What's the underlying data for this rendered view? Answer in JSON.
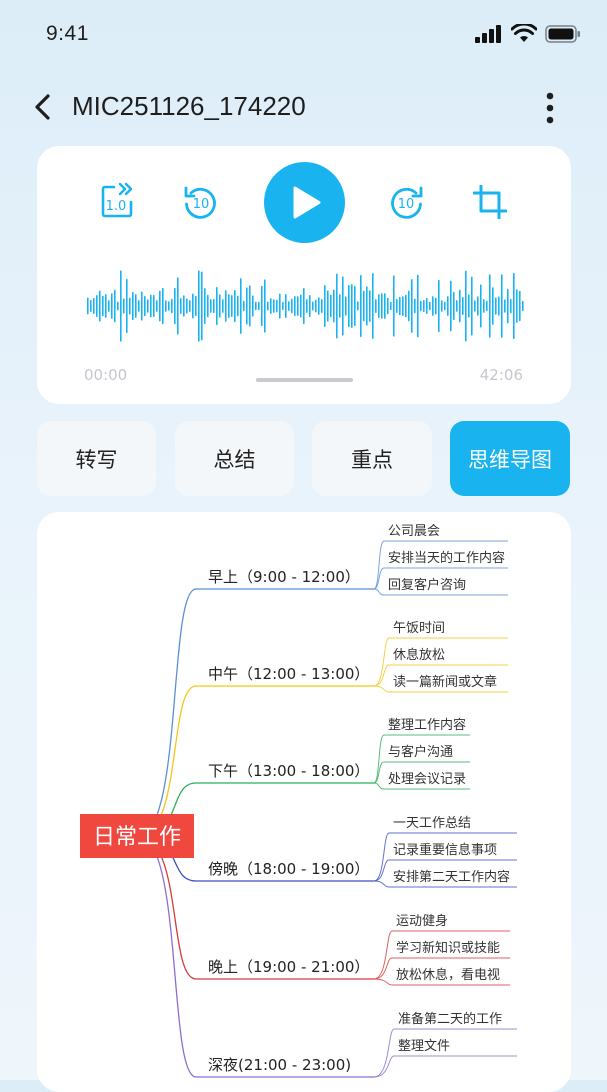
{
  "status_bar": {
    "time": "9:41"
  },
  "header": {
    "title": "MIC251126_174220"
  },
  "player": {
    "speed_label": "1.0",
    "rewind_label": "10",
    "forward_label": "10",
    "current_time": "00:00",
    "total_time": "42:06",
    "accent": "#19b3f0"
  },
  "tabs": [
    {
      "label": "转写",
      "active": false
    },
    {
      "label": "总结",
      "active": false
    },
    {
      "label": "重点",
      "active": false
    },
    {
      "label": "思维导图",
      "active": true
    }
  ],
  "mindmap": {
    "root": "日常工作",
    "root_color": "#f0483e",
    "branches": [
      {
        "label": "早上（9:00 - 12:00）",
        "color": "#5b8fd6",
        "items": [
          "公司晨会",
          "安排当天的工作内容",
          "回复客户咨询"
        ]
      },
      {
        "label": "中午（12:00 - 13:00）",
        "color": "#f5c518",
        "items": [
          "午饭时间",
          "休息放松",
          "读一篇新闻或文章"
        ]
      },
      {
        "label": "下午（13:00 - 18:00）",
        "color": "#2eae5a",
        "items": [
          "整理工作内容",
          "与客户沟通",
          "处理会议记录"
        ]
      },
      {
        "label": "傍晚（18:00 - 19:00）",
        "color": "#3a4fc7",
        "items": [
          "一天工作总结",
          "记录重要信息事项",
          "安排第二天工作内容"
        ]
      },
      {
        "label": "晚上（19:00 - 21:00）",
        "color": "#d93a3a",
        "items": [
          "运动健身",
          "学习新知识或技能",
          "放松休息，看电视"
        ]
      },
      {
        "label": "深夜(21:00 - 23:00)",
        "color": "#8c6fd1",
        "items": [
          "准备第二天的工作",
          "整理文件"
        ]
      }
    ]
  }
}
